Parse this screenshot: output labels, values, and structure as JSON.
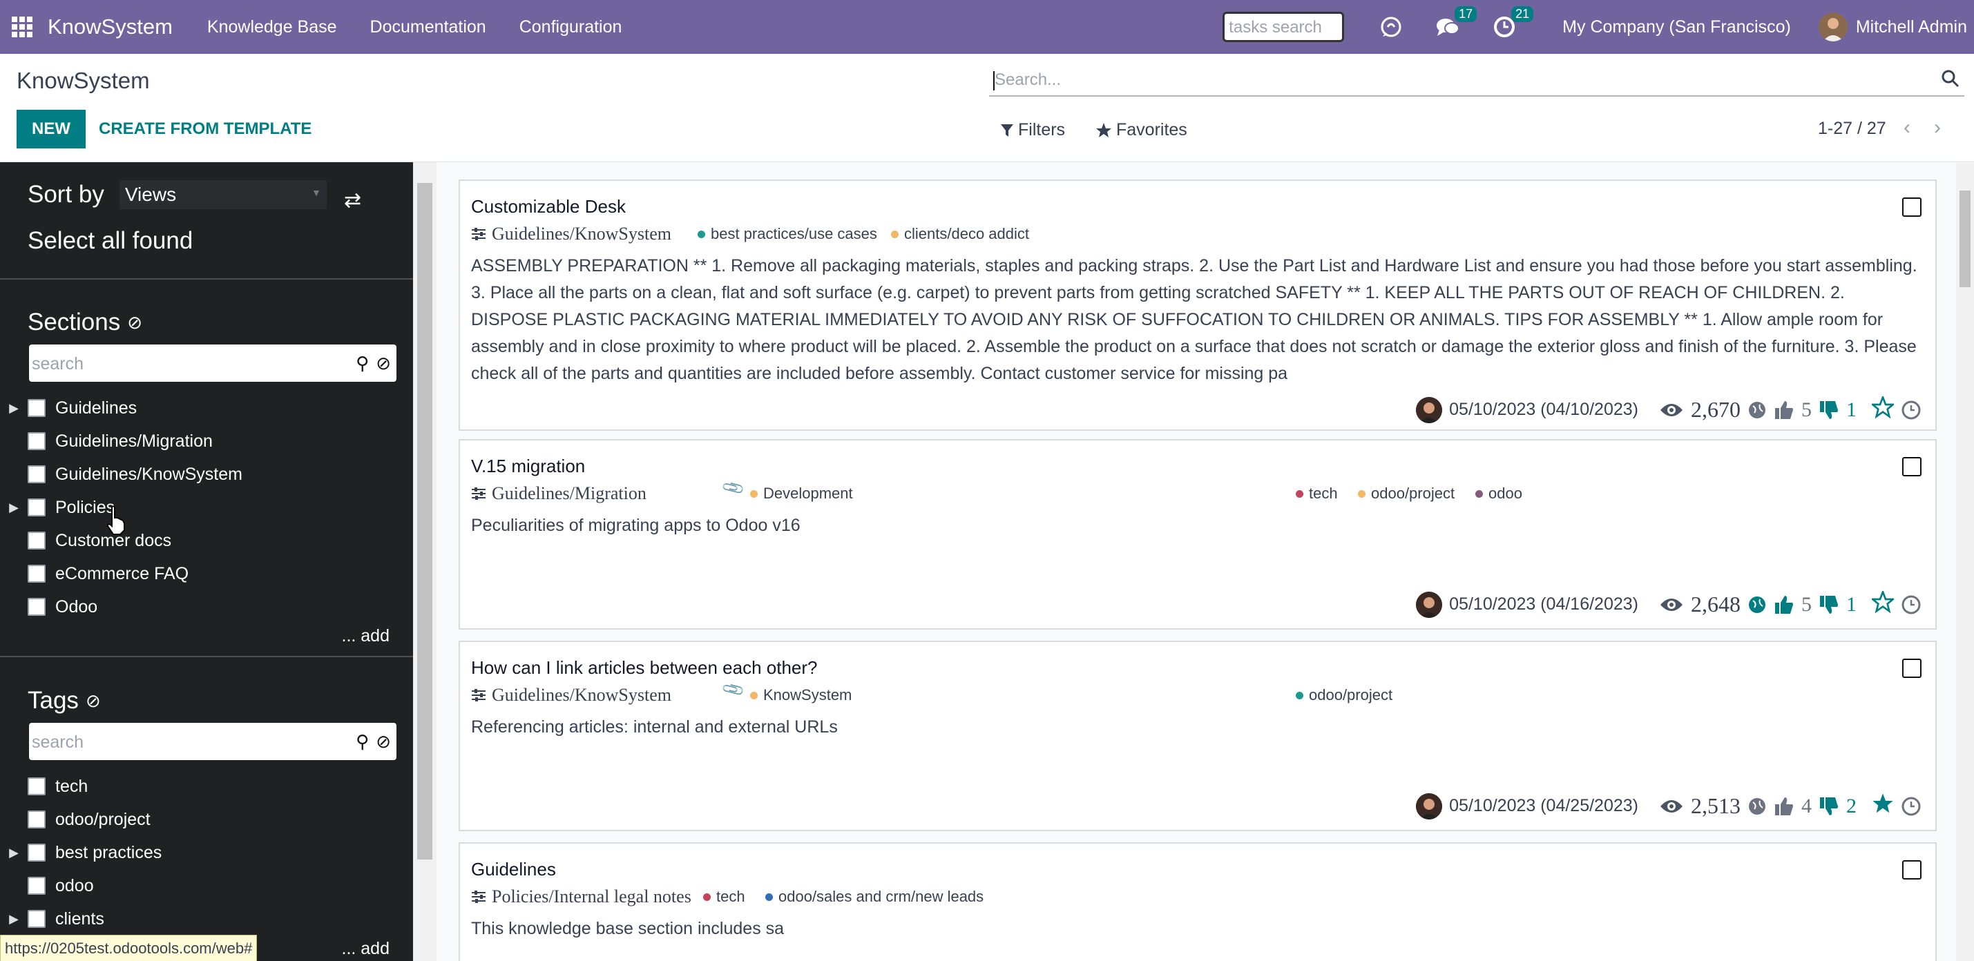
{
  "navbar": {
    "brand": "KnowSystem",
    "menu": [
      "Knowledge Base",
      "Documentation",
      "Configuration"
    ],
    "tasks_search_placeholder": "tasks search",
    "messages_badge": "17",
    "activities_badge": "21",
    "company": "My Company (San Francisco)",
    "user": "Mitchell Admin"
  },
  "control": {
    "breadcrumb": "KnowSystem",
    "new_label": "NEW",
    "template_label": "CREATE FROM TEMPLATE",
    "search_placeholder": "Search...",
    "filters_label": "Filters",
    "favorites_label": "Favorites",
    "pager": "1-27 / 27"
  },
  "sidebar": {
    "sort_label": "Sort by",
    "sort_value": "Views",
    "select_all": "Select all found",
    "sections_title": "Sections",
    "sections_search": "search",
    "sections": [
      {
        "label": "Guidelines",
        "expandable": true
      },
      {
        "label": "Guidelines/Migration",
        "expandable": false
      },
      {
        "label": "Guidelines/KnowSystem",
        "expandable": false
      },
      {
        "label": "Policies",
        "expandable": true
      },
      {
        "label": "Customer docs",
        "expandable": false
      },
      {
        "label": "eCommerce FAQ",
        "expandable": false
      },
      {
        "label": "Odoo",
        "expandable": false
      }
    ],
    "add_label": "... add",
    "tags_title": "Tags",
    "tags_search": "search",
    "tags": [
      {
        "label": "tech",
        "expandable": false
      },
      {
        "label": "odoo/project",
        "expandable": false
      },
      {
        "label": "best practices",
        "expandable": true
      },
      {
        "label": "odoo",
        "expandable": false
      },
      {
        "label": "clients",
        "expandable": true
      }
    ],
    "tags_add_label": "... add"
  },
  "status_url": "https://0205test.odootools.com/web#",
  "colors": {
    "navbar": "#71639e",
    "primary": "#017e84"
  },
  "articles": [
    {
      "title": "Customizable Desk",
      "section": "Guidelines/KnowSystem",
      "tags": [
        {
          "label": "best practices/use cases",
          "color": "#1d9a8f"
        },
        {
          "label": "clients/deco addict",
          "color": "#f0b867"
        }
      ],
      "right_tags": [],
      "body": "ASSEMBLY PREPARATION ** 1. Remove all packaging materials, staples and packing straps. 2. Use the Part List and Hardware List and ensure you had those before you start assembling. 3. Place all the parts on a clean, flat and soft surface (e.g. carpet) to prevent parts from getting scratched SAFETY ** 1. KEEP ALL THE PARTS OUT OF REACH OF CHILDREN. 2. DISPOSE PLASTIC PACKAGING MATERIAL IMMEDIATELY TO AVOID ANY RISK OF SUFFOCATION TO CHILDREN OR ANIMALS. TIPS FOR ASSEMBLY ** 1. Allow ample room for assembly and in close proximity to where product will be placed. 2. Assemble the product on a surface that does not scratch or damage the exterior gloss and finish of the furniture. 3. Please check all of the parts and quantities are included before assembly. Contact customer service for missing pa",
      "date": "05/10/2023 (04/10/2023)",
      "views": "2,670",
      "likes": "5",
      "dislikes": "1",
      "favorite": false
    },
    {
      "title": "V.15 migration",
      "section": "Guidelines/Migration",
      "tags": [
        {
          "label": "Development",
          "color": "#f0b867"
        }
      ],
      "right_tags": [
        {
          "label": "tech",
          "color": "#c2455d"
        },
        {
          "label": "odoo/project",
          "color": "#f0b867"
        },
        {
          "label": "odoo",
          "color": "#875a7b"
        }
      ],
      "body": "Peculiarities of migrating apps to Odoo v16",
      "date": "05/10/2023 (04/16/2023)",
      "views": "2,648",
      "likes": "5",
      "dislikes": "1",
      "favorite": false
    },
    {
      "title": "How can I link articles between each other?",
      "section": "Guidelines/KnowSystem",
      "tags": [
        {
          "label": "KnowSystem",
          "color": "#f0b867"
        }
      ],
      "right_tags": [
        {
          "label": "odoo/project",
          "color": "#1d9a8f"
        }
      ],
      "body": "Referencing articles: internal and external URLs",
      "date": "05/10/2023 (04/25/2023)",
      "views": "2,513",
      "likes": "4",
      "dislikes": "2",
      "favorite": true
    },
    {
      "title": "Guidelines",
      "section": "Policies/Internal legal notes",
      "tags": [
        {
          "label": "tech",
          "color": "#c2455d"
        },
        {
          "label": "odoo/sales and crm/new leads",
          "color": "#2f6fb5"
        }
      ],
      "right_tags": [],
      "body": "This knowledge base section includes sa"
    }
  ]
}
